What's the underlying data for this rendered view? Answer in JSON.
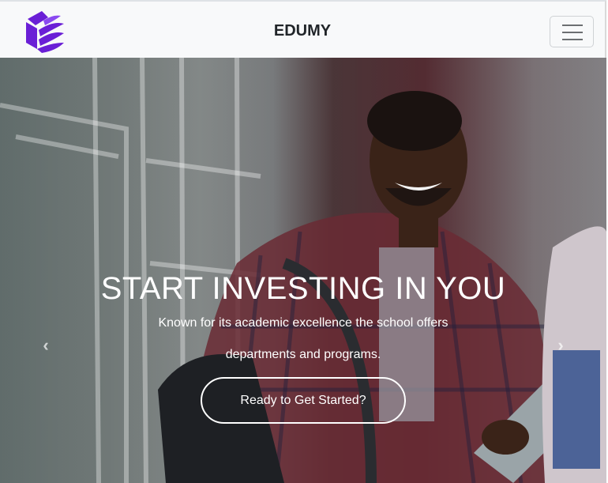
{
  "header": {
    "brand": "EDUMY",
    "logo": "edumy-logo",
    "menu_icon": "hamburger-icon"
  },
  "hero": {
    "headline": "START INVESTING IN YOU",
    "subtitle_line1": "Known for its academic excellence the school offers",
    "subtitle_line2": "departments and programs.",
    "cta_label": "Ready to Get Started?",
    "prev_icon": "‹",
    "next_icon": "›"
  },
  "colors": {
    "navbar_bg": "#f8f9fa",
    "logo": "#6a1fd6",
    "text_light": "#ffffff"
  }
}
